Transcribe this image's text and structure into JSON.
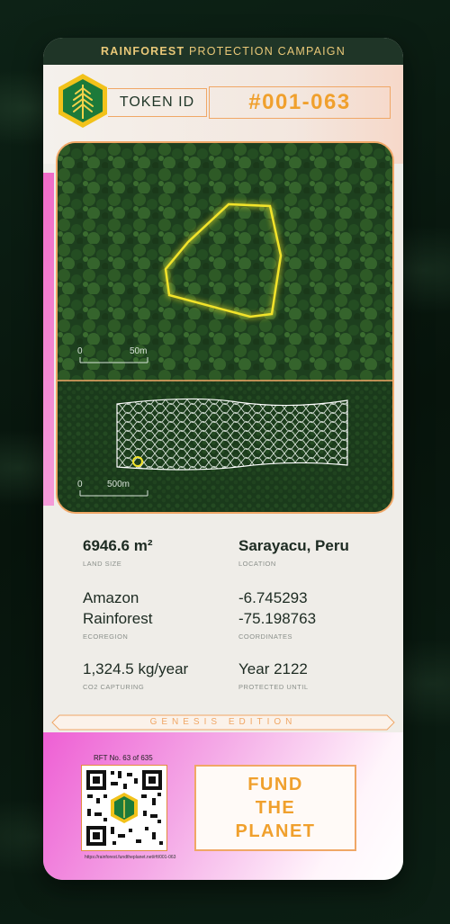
{
  "campaign": {
    "title_bold": "RAINFOREST",
    "title_rest": " PROTECTION CAMPAIGN"
  },
  "token": {
    "label": "TOKEN ID",
    "value": "#001-063"
  },
  "badge_icon": "palm-leaf-icon",
  "map": {
    "scale_top": {
      "zero": "0",
      "end": "50m"
    },
    "scale_bottom": {
      "zero": "0",
      "end": "500m"
    }
  },
  "stats": {
    "land_size": {
      "value": "6946.6 m²",
      "label": "LAND SIZE"
    },
    "location": {
      "value": "Sarayacu, Peru",
      "label": "LOCATION"
    },
    "ecoregion": {
      "value_line1": "Amazon",
      "value_line2": "Rainforest",
      "label": "ECOREGION"
    },
    "coordinates": {
      "value_line1": "-6.745293",
      "value_line2": "-75.198763",
      "label": "COORDINATES"
    },
    "co2": {
      "value": "1,324.5 kg/year",
      "label": "CO2 CAPTURING"
    },
    "protected": {
      "value": "Year 2122",
      "label": "PROTECTED UNTIL"
    }
  },
  "edition": "GENESIS EDITION",
  "rft": "RFT No. 63 of 635",
  "qr_url": "https://rainforest.fundtheplanet.net/rft/001-063",
  "cta": {
    "line1": "FUND",
    "line2": "THE",
    "line3": "PLANET"
  },
  "colors": {
    "accent": "#f0a02d",
    "dark_green": "#1f3527",
    "highlight_yellow": "#f2e32a",
    "pink": "#f06cc8"
  }
}
